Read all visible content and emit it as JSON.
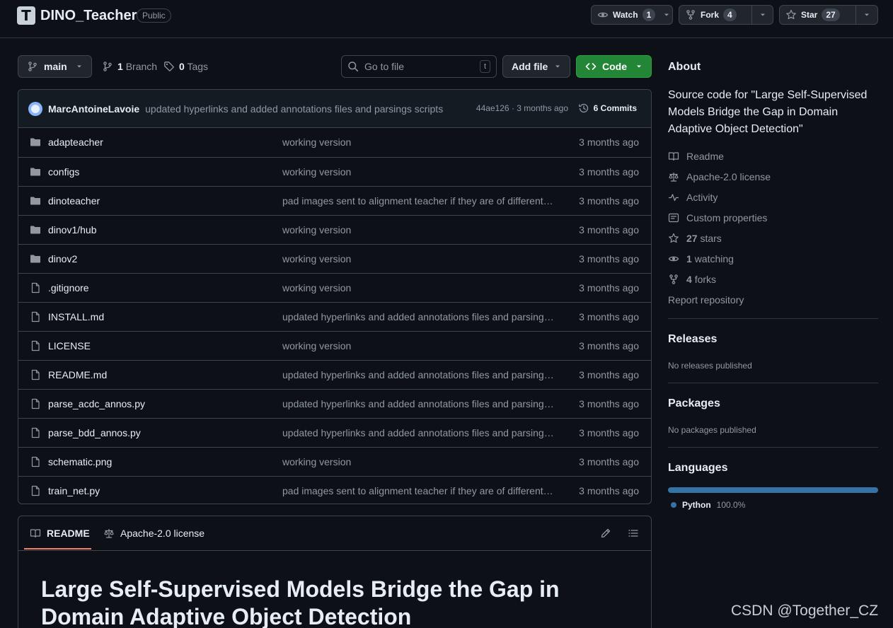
{
  "header": {
    "logo_letter": "T",
    "repo_name": "DINO_Teacher",
    "visibility": "Public",
    "watch_label": "Watch",
    "watch_count": "1",
    "fork_label": "Fork",
    "fork_count": "4",
    "star_label": "Star",
    "star_count": "27"
  },
  "toolbar": {
    "branch_name": "main",
    "branches_count": "1",
    "branches_label": "Branch",
    "tags_count": "0",
    "tags_label": "Tags",
    "search_placeholder": "Go to file",
    "search_shortcut": "t",
    "add_file_label": "Add file",
    "code_label": "Code"
  },
  "latest_commit": {
    "author": "MarcAntoineLavoie",
    "message": "updated hyperlinks and added annotations files and parsings scripts",
    "meta": "44ae126 · 3 months ago",
    "commits_label": "6 Commits"
  },
  "files": [
    {
      "type": "dir",
      "name": "adapteacher",
      "message": "working version",
      "date": "3 months ago"
    },
    {
      "type": "dir",
      "name": "configs",
      "message": "working version",
      "date": "3 months ago"
    },
    {
      "type": "dir",
      "name": "dinoteacher",
      "message": "pad images sent to alignment teacher if they are of different…",
      "date": "3 months ago"
    },
    {
      "type": "dir",
      "name": "dinov1/hub",
      "message": "working version",
      "date": "3 months ago"
    },
    {
      "type": "dir",
      "name": "dinov2",
      "message": "working version",
      "date": "3 months ago"
    },
    {
      "type": "file",
      "name": ".gitignore",
      "message": "working version",
      "date": "3 months ago"
    },
    {
      "type": "file",
      "name": "INSTALL.md",
      "message": "updated hyperlinks and added annotations files and parsing…",
      "date": "3 months ago"
    },
    {
      "type": "file",
      "name": "LICENSE",
      "message": "working version",
      "date": "3 months ago"
    },
    {
      "type": "file",
      "name": "README.md",
      "message": "updated hyperlinks and added annotations files and parsing…",
      "date": "3 months ago"
    },
    {
      "type": "file",
      "name": "parse_acdc_annos.py",
      "message": "updated hyperlinks and added annotations files and parsing…",
      "date": "3 months ago"
    },
    {
      "type": "file",
      "name": "parse_bdd_annos.py",
      "message": "updated hyperlinks and added annotations files and parsing…",
      "date": "3 months ago"
    },
    {
      "type": "file",
      "name": "schematic.png",
      "message": "working version",
      "date": "3 months ago"
    },
    {
      "type": "file",
      "name": "train_net.py",
      "message": "pad images sent to alignment teacher if they are of different…",
      "date": "3 months ago"
    }
  ],
  "readme": {
    "tab_readme": "README",
    "tab_license": "Apache-2.0 license",
    "title": "Large Self-Supervised Models Bridge the Gap in Domain Adaptive Object Detection"
  },
  "sidebar": {
    "about_heading": "About",
    "description": "Source code for \"Large Self-Supervised Models Bridge the Gap in Domain Adaptive Object Detection\"",
    "readme_link": "Readme",
    "license_link": "Apache-2.0 license",
    "activity_link": "Activity",
    "custom_props_link": "Custom properties",
    "stars_count": "27",
    "stars_label": "stars",
    "watching_count": "1",
    "watching_label": "watching",
    "forks_count": "4",
    "forks_label": "forks",
    "report_link": "Report repository",
    "releases_heading": "Releases",
    "releases_text": "No releases published",
    "packages_heading": "Packages",
    "packages_text": "No packages published",
    "languages_heading": "Languages",
    "language_name": "Python",
    "language_pct": "100.0%",
    "language_share": 1.0
  },
  "colors": {
    "background": "#0d1117",
    "border": "#3d444d",
    "code_button": "#238636",
    "python": "#3572a5",
    "active_tab": "#f78166"
  },
  "watermark": "CSDN @Together_CZ"
}
